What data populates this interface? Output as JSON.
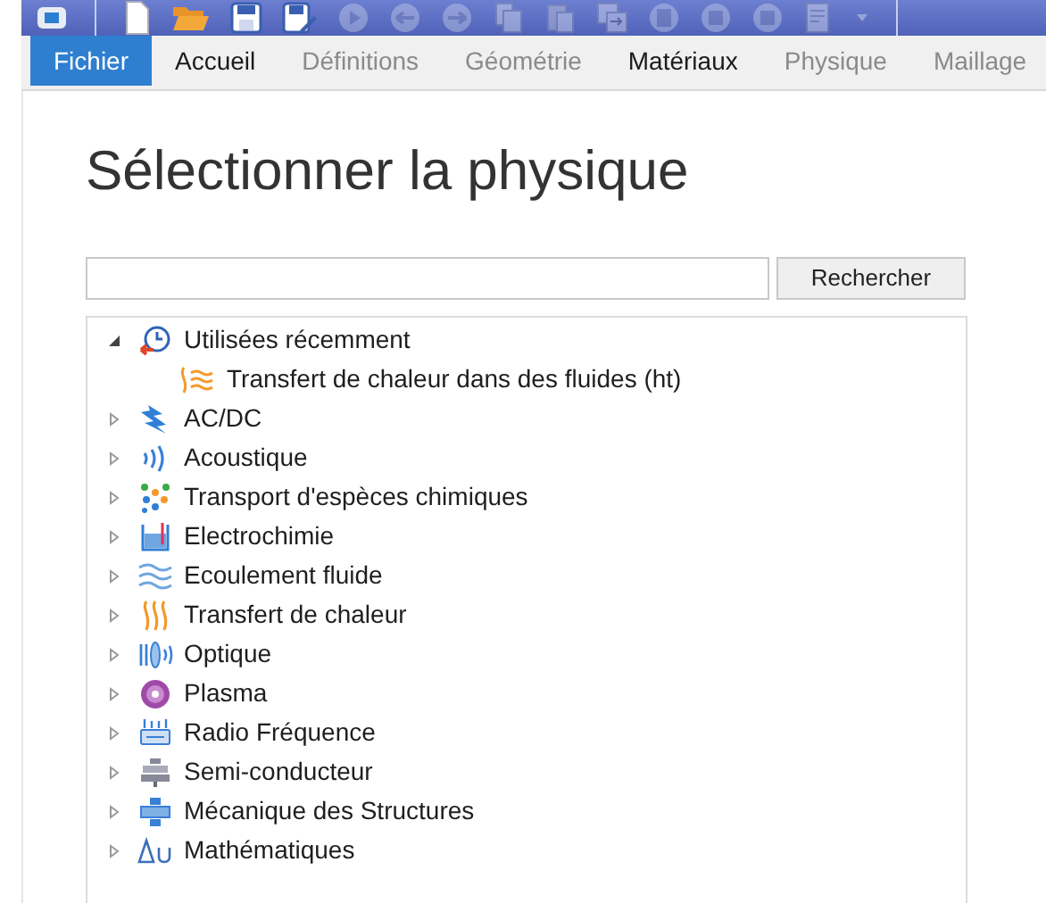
{
  "toolbar": [
    {
      "kind": "app",
      "disabled": false
    },
    {
      "kind": "separator"
    },
    {
      "kind": "new",
      "disabled": false
    },
    {
      "kind": "open",
      "disabled": false
    },
    {
      "kind": "save",
      "disabled": false
    },
    {
      "kind": "save-as",
      "disabled": false
    },
    {
      "kind": "play",
      "disabled": true
    },
    {
      "kind": "undo",
      "disabled": true
    },
    {
      "kind": "redo",
      "disabled": true
    },
    {
      "kind": "copy",
      "disabled": true
    },
    {
      "kind": "paste",
      "disabled": true
    },
    {
      "kind": "duplicate",
      "disabled": true
    },
    {
      "kind": "delete",
      "disabled": true
    },
    {
      "kind": "square",
      "disabled": true
    },
    {
      "kind": "square",
      "disabled": true
    },
    {
      "kind": "document",
      "disabled": true
    },
    {
      "kind": "dropdown",
      "disabled": true
    },
    {
      "kind": "separator"
    }
  ],
  "tabs": [
    {
      "label": "Fichier",
      "selected": true,
      "disabled": false
    },
    {
      "label": "Accueil",
      "selected": false,
      "disabled": false
    },
    {
      "label": "Définitions",
      "selected": false,
      "disabled": true
    },
    {
      "label": "Géométrie",
      "selected": false,
      "disabled": true
    },
    {
      "label": "Matériaux",
      "selected": false,
      "disabled": false
    },
    {
      "label": "Physique",
      "selected": false,
      "disabled": true
    },
    {
      "label": "Maillage",
      "selected": false,
      "disabled": true
    }
  ],
  "title": "Sélectionner la physique",
  "search": {
    "button": "Rechercher"
  },
  "tree": [
    {
      "label": "Utilisées récemment",
      "kind": "recent",
      "expanded": true,
      "children": [
        {
          "label": "Transfert de chaleur dans des fluides (ht)",
          "kind": "heat-fluid"
        }
      ]
    },
    {
      "label": "AC/DC",
      "kind": "acdc",
      "expanded": false
    },
    {
      "label": "Acoustique",
      "kind": "acoustic",
      "expanded": false
    },
    {
      "label": "Transport d'espèces chimiques",
      "kind": "chem",
      "expanded": false
    },
    {
      "label": "Electrochimie",
      "kind": "electrochem",
      "expanded": false
    },
    {
      "label": "Ecoulement fluide",
      "kind": "fluid",
      "expanded": false
    },
    {
      "label": "Transfert de chaleur",
      "kind": "heat",
      "expanded": false
    },
    {
      "label": "Optique",
      "kind": "optics",
      "expanded": false
    },
    {
      "label": "Plasma",
      "kind": "plasma",
      "expanded": false
    },
    {
      "label": "Radio Fréquence",
      "kind": "rf",
      "expanded": false
    },
    {
      "label": "Semi-conducteur",
      "kind": "semi",
      "expanded": false
    },
    {
      "label": "Mécanique des Structures",
      "kind": "struct",
      "expanded": false
    },
    {
      "label": "Mathématiques",
      "kind": "math",
      "expanded": false
    }
  ]
}
